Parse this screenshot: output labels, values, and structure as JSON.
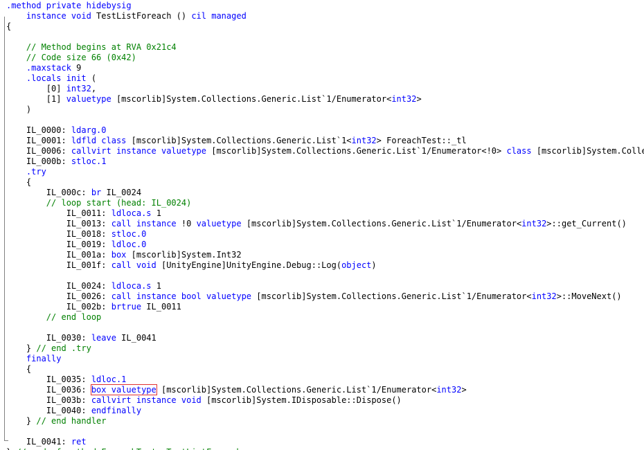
{
  "colors": {
    "keyword": "#0000ff",
    "comment": "#008000",
    "text": "#000000",
    "highlight_border": "#e03030",
    "fold_guide": "#808080"
  },
  "lines": [
    [
      {
        "t": ".method private hidebysig",
        "k": "kw"
      }
    ],
    [
      {
        "t": "    ",
        "k": "tx"
      },
      {
        "t": "instance void",
        "k": "kw"
      },
      {
        "t": " TestListForeach () ",
        "k": "tx"
      },
      {
        "t": "cil managed",
        "k": "kw"
      }
    ],
    [
      {
        "t": "{",
        "k": "tx"
      }
    ],
    [],
    [
      {
        "t": "    // Method begins at RVA 0x21c4",
        "k": "cm"
      }
    ],
    [
      {
        "t": "    // Code size 66 (0x42)",
        "k": "cm"
      }
    ],
    [
      {
        "t": "    ",
        "k": "tx"
      },
      {
        "t": ".maxstack",
        "k": "kw"
      },
      {
        "t": " 9",
        "k": "tx"
      }
    ],
    [
      {
        "t": "    ",
        "k": "tx"
      },
      {
        "t": ".locals init",
        "k": "kw"
      },
      {
        "t": " (",
        "k": "tx"
      }
    ],
    [
      {
        "t": "        [0] ",
        "k": "tx"
      },
      {
        "t": "int32",
        "k": "kw"
      },
      {
        "t": ",",
        "k": "tx"
      }
    ],
    [
      {
        "t": "        [1] ",
        "k": "tx"
      },
      {
        "t": "valuetype",
        "k": "kw"
      },
      {
        "t": " [mscorlib]System.Collections.Generic.List`1/Enumerator<",
        "k": "tx"
      },
      {
        "t": "int32",
        "k": "kw"
      },
      {
        "t": ">",
        "k": "tx"
      }
    ],
    [
      {
        "t": "    )",
        "k": "tx"
      }
    ],
    [],
    [
      {
        "t": "    IL_0000: ",
        "k": "tx"
      },
      {
        "t": "ldarg.0",
        "k": "kw"
      }
    ],
    [
      {
        "t": "    IL_0001: ",
        "k": "tx"
      },
      {
        "t": "ldfld",
        "k": "kw"
      },
      {
        "t": " ",
        "k": "tx"
      },
      {
        "t": "class",
        "k": "kw"
      },
      {
        "t": " [mscorlib]System.Collections.Generic.List`1<",
        "k": "tx"
      },
      {
        "t": "int32",
        "k": "kw"
      },
      {
        "t": "> ForeachTest::_tl",
        "k": "tx"
      }
    ],
    [
      {
        "t": "    IL_0006: ",
        "k": "tx"
      },
      {
        "t": "callvirt",
        "k": "kw"
      },
      {
        "t": " ",
        "k": "tx"
      },
      {
        "t": "instance valuetype",
        "k": "kw"
      },
      {
        "t": " [mscorlib]System.Collections.Generic.List`1/Enumerator<!0> ",
        "k": "tx"
      },
      {
        "t": "class",
        "k": "kw"
      },
      {
        "t": " [mscorlib]System.Collectio",
        "k": "tx"
      }
    ],
    [
      {
        "t": "    IL_000b: ",
        "k": "tx"
      },
      {
        "t": "stloc.1",
        "k": "kw"
      }
    ],
    [
      {
        "t": "    ",
        "k": "tx"
      },
      {
        "t": ".try",
        "k": "kw"
      }
    ],
    [
      {
        "t": "    {",
        "k": "tx"
      }
    ],
    [
      {
        "t": "        IL_000c: ",
        "k": "tx"
      },
      {
        "t": "br",
        "k": "kw"
      },
      {
        "t": " IL_0024",
        "k": "tx"
      }
    ],
    [
      {
        "t": "        // loop start (head: IL_0024)",
        "k": "cm"
      }
    ],
    [
      {
        "t": "            IL_0011: ",
        "k": "tx"
      },
      {
        "t": "ldloca.s",
        "k": "kw"
      },
      {
        "t": " 1",
        "k": "tx"
      }
    ],
    [
      {
        "t": "            IL_0013: ",
        "k": "tx"
      },
      {
        "t": "call",
        "k": "kw"
      },
      {
        "t": " ",
        "k": "tx"
      },
      {
        "t": "instance",
        "k": "kw"
      },
      {
        "t": " !0 ",
        "k": "tx"
      },
      {
        "t": "valuetype",
        "k": "kw"
      },
      {
        "t": " [mscorlib]System.Collections.Generic.List`1/Enumerator<",
        "k": "tx"
      },
      {
        "t": "int32",
        "k": "kw"
      },
      {
        "t": ">::get_Current()",
        "k": "tx"
      }
    ],
    [
      {
        "t": "            IL_0018: ",
        "k": "tx"
      },
      {
        "t": "stloc.0",
        "k": "kw"
      }
    ],
    [
      {
        "t": "            IL_0019: ",
        "k": "tx"
      },
      {
        "t": "ldloc.0",
        "k": "kw"
      }
    ],
    [
      {
        "t": "            IL_001a: ",
        "k": "tx"
      },
      {
        "t": "box",
        "k": "kw"
      },
      {
        "t": " [mscorlib]System.Int32",
        "k": "tx"
      }
    ],
    [
      {
        "t": "            IL_001f: ",
        "k": "tx"
      },
      {
        "t": "call void",
        "k": "kw"
      },
      {
        "t": " [UnityEngine]UnityEngine.Debug::Log(",
        "k": "tx"
      },
      {
        "t": "object",
        "k": "kw"
      },
      {
        "t": ")",
        "k": "tx"
      }
    ],
    [],
    [
      {
        "t": "            IL_0024: ",
        "k": "tx"
      },
      {
        "t": "ldloca.s",
        "k": "kw"
      },
      {
        "t": " 1",
        "k": "tx"
      }
    ],
    [
      {
        "t": "            IL_0026: ",
        "k": "tx"
      },
      {
        "t": "call",
        "k": "kw"
      },
      {
        "t": " ",
        "k": "tx"
      },
      {
        "t": "instance bool valuetype",
        "k": "kw"
      },
      {
        "t": " [mscorlib]System.Collections.Generic.List`1/Enumerator<",
        "k": "tx"
      },
      {
        "t": "int32",
        "k": "kw"
      },
      {
        "t": ">::MoveNext()",
        "k": "tx"
      }
    ],
    [
      {
        "t": "            IL_002b: ",
        "k": "tx"
      },
      {
        "t": "brtrue",
        "k": "kw"
      },
      {
        "t": " IL_0011",
        "k": "tx"
      }
    ],
    [
      {
        "t": "        // end loop",
        "k": "cm"
      }
    ],
    [],
    [
      {
        "t": "        IL_0030: ",
        "k": "tx"
      },
      {
        "t": "leave",
        "k": "kw"
      },
      {
        "t": " IL_0041",
        "k": "tx"
      }
    ],
    [
      {
        "t": "    } ",
        "k": "tx"
      },
      {
        "t": "// end .try",
        "k": "cm"
      }
    ],
    [
      {
        "t": "    ",
        "k": "tx"
      },
      {
        "t": "finally",
        "k": "kw"
      }
    ],
    [
      {
        "t": "    {",
        "k": "tx"
      }
    ],
    [
      {
        "t": "        IL_0035: ",
        "k": "tx"
      },
      {
        "t": "ldloc.1",
        "k": "kw"
      }
    ],
    [
      {
        "t": "        IL_0036: ",
        "k": "tx"
      },
      {
        "t": "box valuetype",
        "k": "kw",
        "hl": true
      },
      {
        "t": " [mscorlib]System.Collections.Generic.List`1/Enumerator<",
        "k": "tx"
      },
      {
        "t": "int32",
        "k": "kw"
      },
      {
        "t": ">",
        "k": "tx"
      }
    ],
    [
      {
        "t": "        IL_003b: ",
        "k": "tx"
      },
      {
        "t": "callvirt",
        "k": "kw"
      },
      {
        "t": " ",
        "k": "tx"
      },
      {
        "t": "instance void",
        "k": "kw"
      },
      {
        "t": " [mscorlib]System.IDisposable::Dispose()",
        "k": "tx"
      }
    ],
    [
      {
        "t": "        IL_0040: ",
        "k": "tx"
      },
      {
        "t": "endfinally",
        "k": "kw"
      }
    ],
    [
      {
        "t": "    } ",
        "k": "tx"
      },
      {
        "t": "// end handler",
        "k": "cm"
      }
    ],
    [],
    [
      {
        "t": "    IL_0041: ",
        "k": "tx"
      },
      {
        "t": "ret",
        "k": "kw"
      }
    ],
    [
      {
        "t": "} ",
        "k": "tx"
      },
      {
        "t": "// end of method ForeachTest::TestListForeach",
        "k": "cm"
      }
    ]
  ]
}
